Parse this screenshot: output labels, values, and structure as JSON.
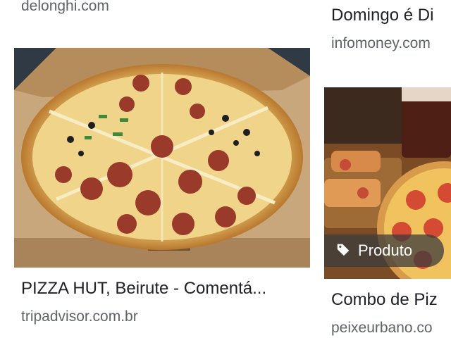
{
  "results": [
    {
      "domain": "delonghi.com"
    },
    {
      "title": "PIZZA HUT, Beirute - Comentá...",
      "domain": "tripadvisor.com.br"
    },
    {
      "title": "Domingo é Di",
      "domain": "infomoney.com"
    },
    {
      "title": "Combo de Piz",
      "domain": "peixeurbano.co",
      "badge": {
        "icon": "tag-icon",
        "label": "Produto"
      }
    }
  ],
  "colors": {
    "text_primary": "#202124",
    "text_secondary": "#5f6368",
    "badge_bg": "#3c3c3c"
  }
}
